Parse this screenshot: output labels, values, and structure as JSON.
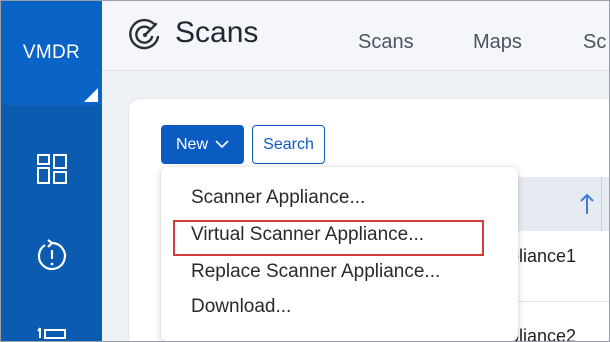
{
  "sidebar": {
    "brand": "VMDR",
    "icons": [
      "dashboard-icon",
      "alert-icon",
      "list-icon"
    ]
  },
  "header": {
    "title": "Scans",
    "tabs": [
      {
        "label": "Scans"
      },
      {
        "label": "Maps"
      },
      {
        "label": "Sc"
      }
    ]
  },
  "toolbar": {
    "new_label": "New",
    "search_label": "Search"
  },
  "menu": {
    "items": [
      {
        "label": "Scanner Appliance..."
      },
      {
        "label": "Virtual Scanner Appliance..."
      },
      {
        "label": "Replace Scanner Appliance..."
      },
      {
        "label": "Download..."
      }
    ],
    "highlighted_index": 1
  },
  "table": {
    "rows": [
      {
        "name_fragment": "pliance1"
      },
      {
        "name_fragment": "pliance2"
      }
    ]
  },
  "colors": {
    "brand": "#0a64c8",
    "sidebar": "#0b5bb0",
    "primary": "#0b5cc2",
    "highlight": "#d43c3c"
  }
}
